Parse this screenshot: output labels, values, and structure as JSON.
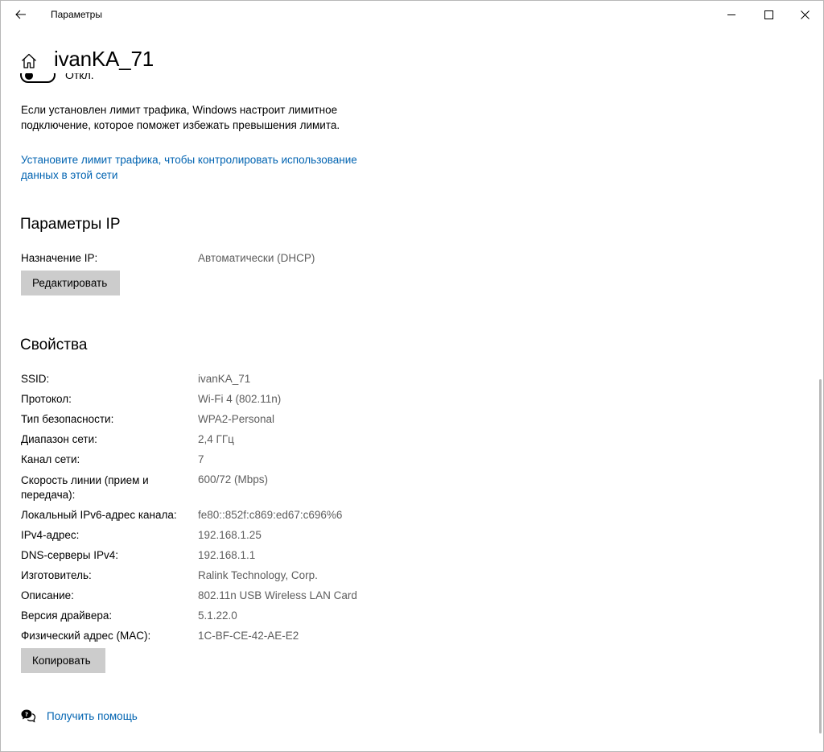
{
  "window": {
    "app_title": "Параметры",
    "back_icon": "back-arrow-icon",
    "minimize_icon": "minimize-icon",
    "maximize_icon": "maximize-icon",
    "close_icon": "close-icon"
  },
  "header": {
    "home_icon": "home-icon",
    "title": "ivanKA_71"
  },
  "metered": {
    "toggle_state": "Откл.",
    "description": "Если установлен лимит трафика, Windows настроит лимитное подключение, которое поможет избежать превышения лимита.",
    "link": "Установите лимит трафика, чтобы контролировать использование данных в этой сети"
  },
  "ip_settings": {
    "title": "Параметры IP",
    "assignment_label": "Назначение IP:",
    "assignment_value": "Автоматически (DHCP)",
    "edit_button": "Редактировать"
  },
  "properties": {
    "title": "Свойства",
    "rows": [
      {
        "label": "SSID:",
        "value": "ivanKA_71"
      },
      {
        "label": "Протокол:",
        "value": "Wi-Fi 4 (802.11n)"
      },
      {
        "label": "Тип безопасности:",
        "value": "WPA2-Personal"
      },
      {
        "label": "Диапазон сети:",
        "value": "2,4 ГГц"
      },
      {
        "label": "Канал сети:",
        "value": "7"
      },
      {
        "label": "Скорость линии (прием и передача):",
        "value": "600/72 (Mbps)"
      },
      {
        "label": "Локальный IPv6-адрес канала:",
        "value": "fe80::852f:c869:ed67:c696%6"
      },
      {
        "label": "IPv4-адрес:",
        "value": "192.168.1.25"
      },
      {
        "label": "DNS-серверы IPv4:",
        "value": "192.168.1.1"
      },
      {
        "label": "Изготовитель:",
        "value": "Ralink Technology, Corp."
      },
      {
        "label": "Описание:",
        "value": "802.11n USB Wireless LAN Card"
      },
      {
        "label": "Версия драйвера:",
        "value": "5.1.22.0"
      },
      {
        "label": "Физический адрес (MAC):",
        "value": "1C-BF-CE-42-AE-E2"
      }
    ],
    "copy_button": "Копировать"
  },
  "help": {
    "icon": "help-chat-icon",
    "label": "Получить помощь"
  },
  "colors": {
    "link": "#0063b1",
    "button_bg": "#cccccc",
    "value_text": "#5d5d5d"
  }
}
